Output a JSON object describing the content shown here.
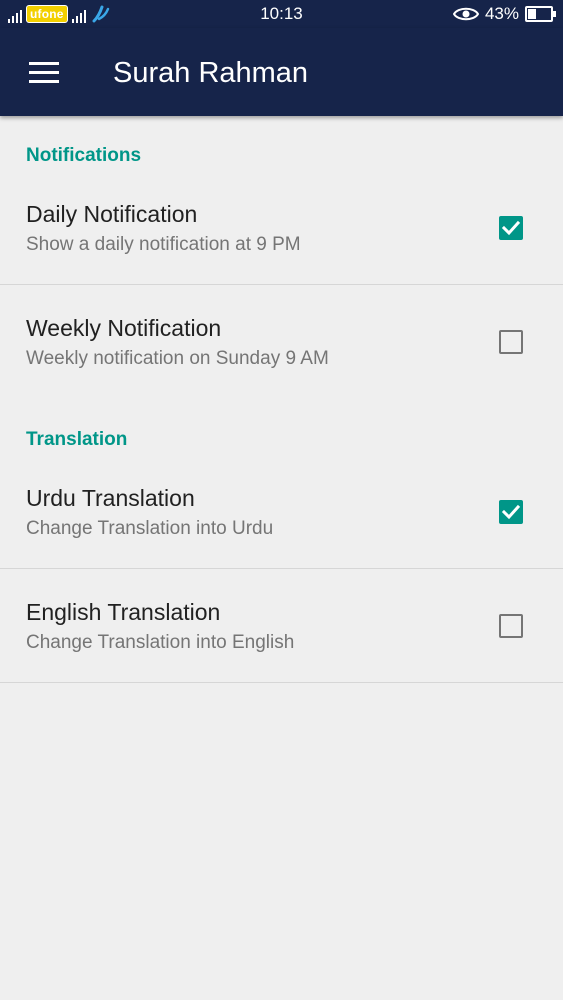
{
  "status_bar": {
    "carrier": "ufone",
    "time": "10:13",
    "battery_percent": "43%",
    "battery_level": 0.43,
    "icons": [
      "signal-icon",
      "carrier2-icon",
      "eye-icon",
      "battery-icon"
    ]
  },
  "toolbar": {
    "title": "Surah Rahman",
    "menu_icon": "hamburger-menu-icon",
    "background": "#16244a"
  },
  "colors": {
    "accent": "#009688",
    "page_background": "#efefef"
  },
  "sections": [
    {
      "header": "Notifications",
      "items": [
        {
          "title": "Daily Notification",
          "summary": "Show a daily notification at 9 PM",
          "checked": true
        },
        {
          "title": "Weekly Notification",
          "summary": "Weekly notification on Sunday 9 AM",
          "checked": false
        }
      ]
    },
    {
      "header": "Translation",
      "items": [
        {
          "title": "Urdu Translation",
          "summary": "Change Translation into Urdu",
          "checked": true
        },
        {
          "title": "English Translation",
          "summary": "Change Translation into English",
          "checked": false
        }
      ]
    }
  ]
}
